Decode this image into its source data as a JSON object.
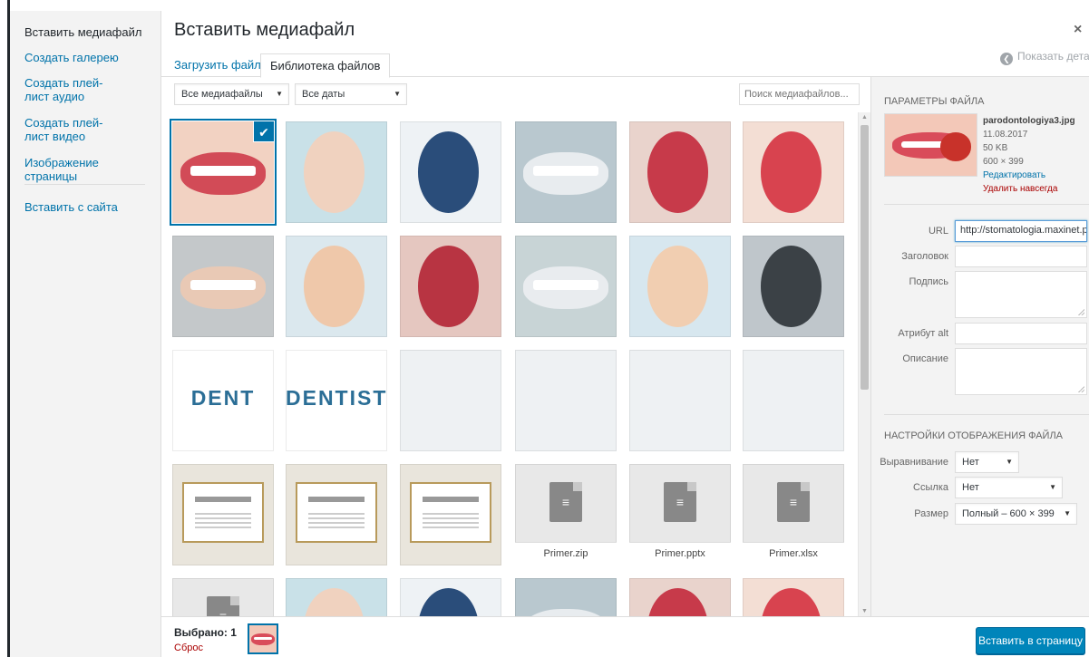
{
  "sidebar": {
    "items": [
      {
        "label": "Вставить медиафайл",
        "active": true
      },
      {
        "label": "Создать галерею"
      },
      {
        "label": "Создать плей-лист аудио"
      },
      {
        "label": "Создать плей-лист видео"
      },
      {
        "label": "Изображение страницы"
      }
    ],
    "insert_from_url": "Вставить с сайта"
  },
  "modal": {
    "title": "Вставить медиафайл",
    "close_icon": "×",
    "show_details": "Показать детали"
  },
  "tabs": [
    {
      "label": "Загрузить файлы",
      "active": false
    },
    {
      "label": "Библиотека файлов",
      "active": true
    }
  ],
  "filters": {
    "type": "Все медиафайлы",
    "date": "Все даты",
    "search_placeholder": "Поиск медиафайлов..."
  },
  "media": [
    {
      "type": "image",
      "desc": "teeth-apple",
      "selected": true
    },
    {
      "type": "image",
      "desc": "woman-smile"
    },
    {
      "type": "image",
      "desc": "doctor-portrait"
    },
    {
      "type": "image",
      "desc": "dental-chair"
    },
    {
      "type": "image",
      "desc": "tooth-extraction"
    },
    {
      "type": "image",
      "desc": "smile-teeth"
    },
    {
      "type": "image",
      "desc": "man-denture"
    },
    {
      "type": "image",
      "desc": "child-dentist"
    },
    {
      "type": "image",
      "desc": "mouth-mirror"
    },
    {
      "type": "image",
      "desc": "dentist-patient"
    },
    {
      "type": "image",
      "desc": "girl-dentist"
    },
    {
      "type": "image",
      "desc": "dental-drill"
    },
    {
      "type": "text",
      "text": "DENT"
    },
    {
      "type": "text",
      "text": "DENTIST"
    },
    {
      "type": "blank"
    },
    {
      "type": "blank"
    },
    {
      "type": "blank"
    },
    {
      "type": "blank"
    },
    {
      "type": "document",
      "desc": "certificate"
    },
    {
      "type": "document",
      "desc": "license"
    },
    {
      "type": "document",
      "desc": "gratitude-letter"
    },
    {
      "type": "file",
      "name": "Primer.zip",
      "icon": "zip-file-icon"
    },
    {
      "type": "file",
      "name": "Primer.pptx",
      "icon": "presentation-file-icon"
    },
    {
      "type": "file",
      "name": "Primer.xlsx",
      "icon": "spreadsheet-file-icon"
    },
    {
      "type": "file-partial",
      "icon": "document-file-icon"
    },
    {
      "type": "image",
      "desc": "smile-partial"
    },
    {
      "type": "image",
      "desc": "woman-face-partial"
    },
    {
      "type": "image",
      "desc": "clinic-partial"
    },
    {
      "type": "image",
      "desc": "child-partial"
    },
    {
      "type": "image",
      "desc": "dentist-closeup-partial"
    }
  ],
  "details": {
    "heading": "ПАРАМЕТРЫ ФАЙЛА",
    "filename": "parodontologiya3.jpg",
    "date": "11.08.2017",
    "size": "50 KB",
    "dimensions": "600 × 399",
    "edit_link": "Редактировать",
    "delete_link": "Удалить навсегда",
    "fields": {
      "url_label": "URL",
      "url_value": "http://stomatologia.maxinet.p",
      "title_label": "Заголовок",
      "title_value": "",
      "caption_label": "Подпись",
      "caption_value": "",
      "alt_label": "Атрибут alt",
      "alt_value": "",
      "description_label": "Описание",
      "description_value": ""
    },
    "display": {
      "heading": "НАСТРОЙКИ ОТОБРАЖЕНИЯ ФАЙЛА",
      "align_label": "Выравнивание",
      "align_value": "Нет",
      "link_label": "Ссылка",
      "link_value": "Нет",
      "size_label": "Размер",
      "size_value": "Полный – 600 × 399"
    }
  },
  "footer": {
    "selected": "Выбрано: 1",
    "reset": "Сброс",
    "insert_button": "Вставить в страницу"
  }
}
